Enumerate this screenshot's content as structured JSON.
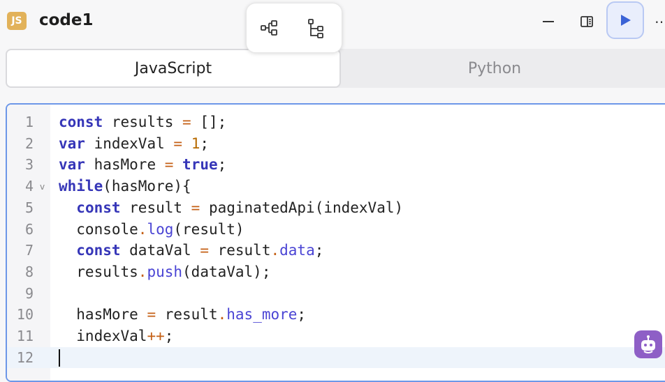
{
  "header": {
    "badge": "JS",
    "title": "code1"
  },
  "toolbar": {
    "tree_icon_1": "graph-tree-icon",
    "tree_icon_2": "hierarchy-tree-icon"
  },
  "window_controls": {
    "minimize": "—",
    "panel": "panel-layout-icon",
    "run": "play-icon",
    "more": "⋯"
  },
  "tabs": [
    {
      "label": "JavaScript",
      "active": true
    },
    {
      "label": "Python",
      "active": false
    }
  ],
  "editor": {
    "line_numbers": [
      "1",
      "2",
      "3",
      "4",
      "5",
      "6",
      "7",
      "8",
      "9",
      "10",
      "11",
      "12"
    ],
    "current_line": 12
  },
  "colors": {
    "accent": "#3b63d6",
    "keyword": "#3636b8",
    "number": "#b76a00",
    "operator": "#c45f14",
    "property": "#4a44d4",
    "bot": "#8e5fc6",
    "badge": "#e2b25a"
  }
}
